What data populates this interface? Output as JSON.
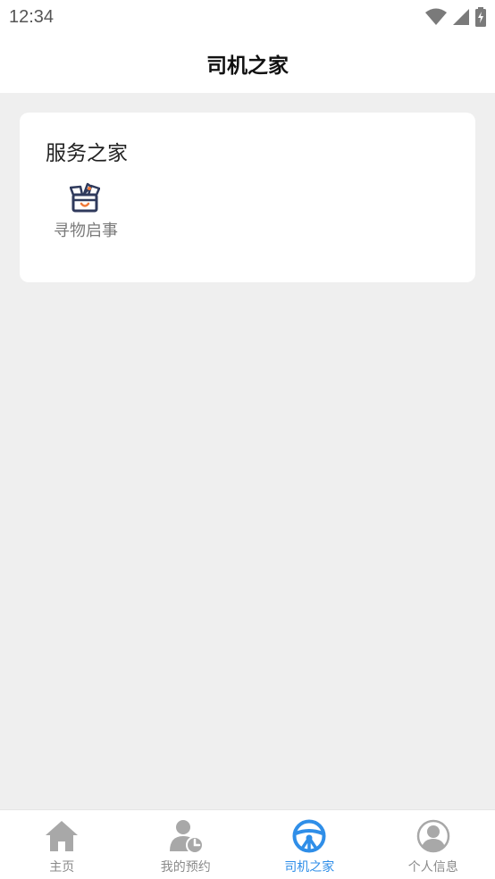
{
  "status_bar": {
    "time": "12:34",
    "icons": [
      "wifi-icon",
      "cellular-signal-icon",
      "battery-charging-icon"
    ]
  },
  "header": {
    "title": "司机之家"
  },
  "service_card": {
    "title": "服务之家",
    "items": [
      {
        "label": "寻物启事",
        "icon": "lost-and-found-box-icon"
      }
    ]
  },
  "bottom_nav": {
    "tabs": [
      {
        "label": "主页",
        "icon": "home-icon",
        "active": false
      },
      {
        "label": "我的预约",
        "icon": "user-clock-icon",
        "active": false
      },
      {
        "label": "司机之家",
        "icon": "steering-wheel-icon",
        "active": true
      },
      {
        "label": "个人信息",
        "icon": "user-circle-icon",
        "active": false
      }
    ]
  },
  "colors": {
    "accent": "#2f8ee8",
    "inactive": "#a8a8a8",
    "background": "#efefef",
    "card": "#ffffff",
    "icon_dark": "#2f3a5c",
    "icon_orange": "#f07a3a"
  }
}
